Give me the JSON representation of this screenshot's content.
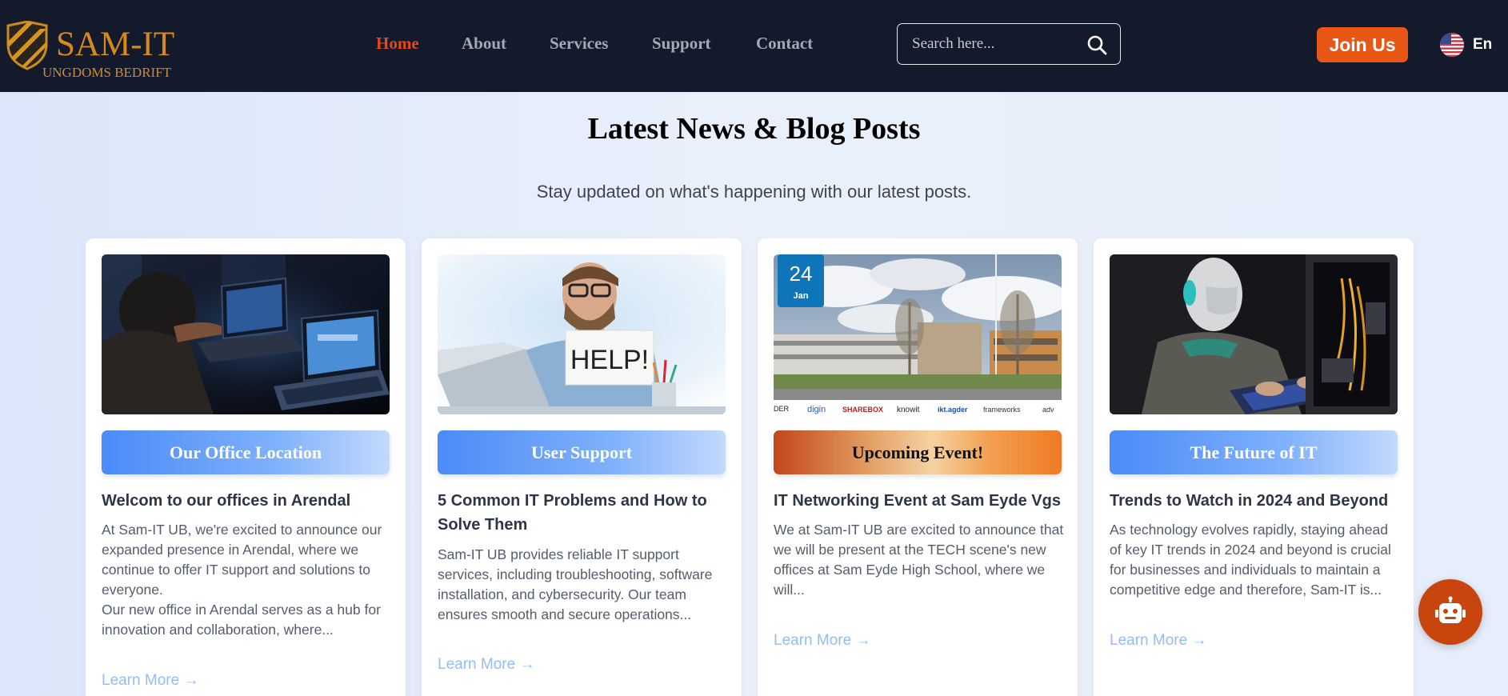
{
  "brand": {
    "title": "SAM-IT",
    "subtitle": "UNGDOMS BEDRIFT"
  },
  "nav": {
    "items": [
      {
        "label": "Home",
        "active": true
      },
      {
        "label": "About"
      },
      {
        "label": "Services"
      },
      {
        "label": "Support"
      },
      {
        "label": "Contact"
      }
    ]
  },
  "search": {
    "placeholder": "Search here...",
    "icon": "search-icon"
  },
  "join_label": "Join Us",
  "language": {
    "label": "En",
    "flag": "us-flag-icon"
  },
  "section": {
    "title": "Latest News & Blog Posts",
    "subtitle": "Stay updated on what's happening with our latest posts."
  },
  "cards": [
    {
      "tag": "Our Office Location",
      "title": "Welcom to our offices in Arendal",
      "excerpt_1": "At Sam-IT UB, we're excited to announce our expanded presence in Arendal, where we continue to offer IT support and solutions to everyone.",
      "excerpt_2": "Our new office in Arendal serves as a hub for innovation and collaboration, where...",
      "link": "Learn More →"
    },
    {
      "tag": "User Support",
      "title": "5 Common IT Problems and How to Solve Them",
      "excerpt_1": "Sam-IT UB provides reliable IT support services, including troubleshooting, software installation, and cybersecurity. Our team ensures smooth and secure operations...",
      "image_text": "HELP!",
      "link": "Learn More →"
    },
    {
      "tag": "Upcoming Event!",
      "title": "IT Networking Event at Sam Eyde Vgs",
      "excerpt_1": "We at Sam-IT UB are excited to announce that we will be present at the TECH scene's new offices at Sam Eyde High School, where we will...",
      "date_day": "24",
      "date_month": "Jan",
      "sponsors": [
        "DER",
        "digin",
        "SHAREBOX",
        "knowit",
        "ikt.agder",
        "frameworks",
        "adv"
      ],
      "link": "Learn More →"
    },
    {
      "tag": "The Future of IT",
      "title": "Trends to Watch in 2024 and Beyond",
      "excerpt_1": "As technology evolves rapidly, staying ahead of key IT trends in 2024 and beyond is crucial for businesses and individuals to maintain a competitive edge and therefore, Sam-IT is...",
      "link": "Learn More →"
    }
  ],
  "colors": {
    "header_bg": "#121a2c",
    "accent_orange": "#e85715",
    "nav_active": "#e8461c",
    "link_blue": "#93bdf3"
  }
}
